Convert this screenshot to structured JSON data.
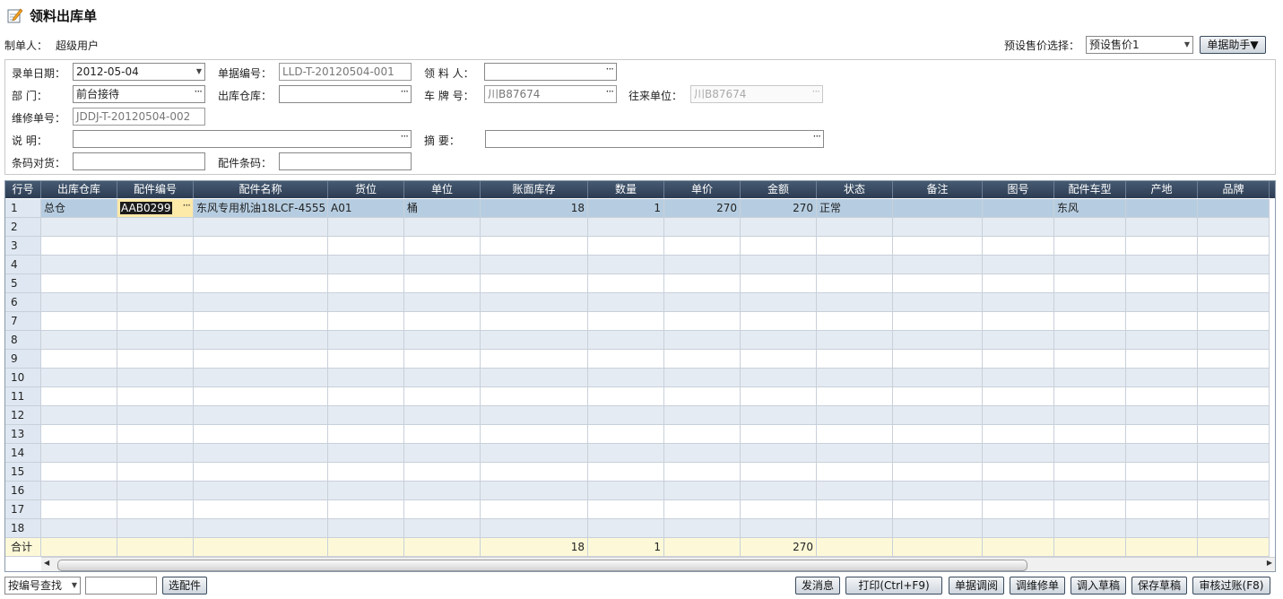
{
  "title": "领料出库单",
  "header": {
    "maker_label": "制单人：",
    "maker_value": "超级用户",
    "price_select_label": "预设售价选择：",
    "price_select_value": "预设售价1",
    "helper_button": "单据助手▼"
  },
  "form": {
    "date_label": "录单日期：",
    "date_value": "2012-05-04",
    "docno_label": "单据编号：",
    "docno_value": "LLD-T-20120504-001",
    "picker_label": "领 料 人：",
    "picker_value": "",
    "dept_label": "部    门：",
    "dept_value": "前台接待",
    "warehouse_label": "出库仓库：",
    "warehouse_value": "",
    "plate_label": "车 牌 号：",
    "plate_value": "川B87674",
    "partner_label": "往来单位：",
    "partner_value": "川B87674",
    "repair_label": "维修单号：",
    "repair_value": "JDDJ-T-20120504-002",
    "note_label": "说    明：",
    "note_value": "",
    "summary_label": "摘    要：",
    "summary_value": "",
    "barcode_goods_label": "条码对货：",
    "barcode_goods_value": "",
    "part_barcode_label": "配件条码：",
    "part_barcode_value": ""
  },
  "grid": {
    "columns": [
      "行号",
      "出库仓库",
      "配件编号",
      "配件名称",
      "货位",
      "单位",
      "账面库存",
      "数量",
      "单价",
      "金额",
      "状态",
      "备注",
      "图号",
      "配件车型",
      "产地",
      "品牌"
    ],
    "rows": [
      [
        "1",
        "总仓",
        "AAB0299",
        "东风专用机油18LCF-4555",
        "A01",
        "桶",
        "18",
        "1",
        "270",
        "270",
        "正常",
        "",
        "",
        "东风",
        "",
        ""
      ],
      [
        "2",
        "",
        "",
        "",
        "",
        "",
        "",
        "",
        "",
        "",
        "",
        "",
        "",
        "",
        "",
        ""
      ],
      [
        "3",
        "",
        "",
        "",
        "",
        "",
        "",
        "",
        "",
        "",
        "",
        "",
        "",
        "",
        "",
        ""
      ],
      [
        "4",
        "",
        "",
        "",
        "",
        "",
        "",
        "",
        "",
        "",
        "",
        "",
        "",
        "",
        "",
        ""
      ],
      [
        "5",
        "",
        "",
        "",
        "",
        "",
        "",
        "",
        "",
        "",
        "",
        "",
        "",
        "",
        "",
        ""
      ],
      [
        "6",
        "",
        "",
        "",
        "",
        "",
        "",
        "",
        "",
        "",
        "",
        "",
        "",
        "",
        "",
        ""
      ],
      [
        "7",
        "",
        "",
        "",
        "",
        "",
        "",
        "",
        "",
        "",
        "",
        "",
        "",
        "",
        "",
        ""
      ],
      [
        "8",
        "",
        "",
        "",
        "",
        "",
        "",
        "",
        "",
        "",
        "",
        "",
        "",
        "",
        "",
        ""
      ],
      [
        "9",
        "",
        "",
        "",
        "",
        "",
        "",
        "",
        "",
        "",
        "",
        "",
        "",
        "",
        "",
        ""
      ],
      [
        "10",
        "",
        "",
        "",
        "",
        "",
        "",
        "",
        "",
        "",
        "",
        "",
        "",
        "",
        "",
        ""
      ],
      [
        "11",
        "",
        "",
        "",
        "",
        "",
        "",
        "",
        "",
        "",
        "",
        "",
        "",
        "",
        "",
        ""
      ],
      [
        "12",
        "",
        "",
        "",
        "",
        "",
        "",
        "",
        "",
        "",
        "",
        "",
        "",
        "",
        "",
        ""
      ],
      [
        "13",
        "",
        "",
        "",
        "",
        "",
        "",
        "",
        "",
        "",
        "",
        "",
        "",
        "",
        "",
        ""
      ],
      [
        "14",
        "",
        "",
        "",
        "",
        "",
        "",
        "",
        "",
        "",
        "",
        "",
        "",
        "",
        "",
        ""
      ],
      [
        "15",
        "",
        "",
        "",
        "",
        "",
        "",
        "",
        "",
        "",
        "",
        "",
        "",
        "",
        "",
        ""
      ],
      [
        "16",
        "",
        "",
        "",
        "",
        "",
        "",
        "",
        "",
        "",
        "",
        "",
        "",
        "",
        "",
        ""
      ],
      [
        "17",
        "",
        "",
        "",
        "",
        "",
        "",
        "",
        "",
        "",
        "",
        "",
        "",
        "",
        "",
        ""
      ],
      [
        "18",
        "",
        "",
        "",
        "",
        "",
        "",
        "",
        "",
        "",
        "",
        "",
        "",
        "",
        "",
        ""
      ]
    ],
    "totals": [
      "合计",
      "",
      "",
      "",
      "",
      "",
      "18",
      "1",
      "",
      "270",
      "",
      "",
      "",
      "",
      "",
      ""
    ]
  },
  "footer": {
    "search_mode": "按编号查找",
    "search_value": "",
    "select_parts_button": "选配件",
    "buttons": [
      "发消息",
      "打印(Ctrl+F9)",
      "单据调阅",
      "调维修单",
      "调入草稿",
      "保存草稿",
      "审核过账(F8)"
    ]
  },
  "colors": {
    "header_bg": "#2c3c52",
    "row_alt": "#e5ebf2",
    "row_selected": "#b6cde1",
    "total_bg": "#fdf9d8"
  }
}
